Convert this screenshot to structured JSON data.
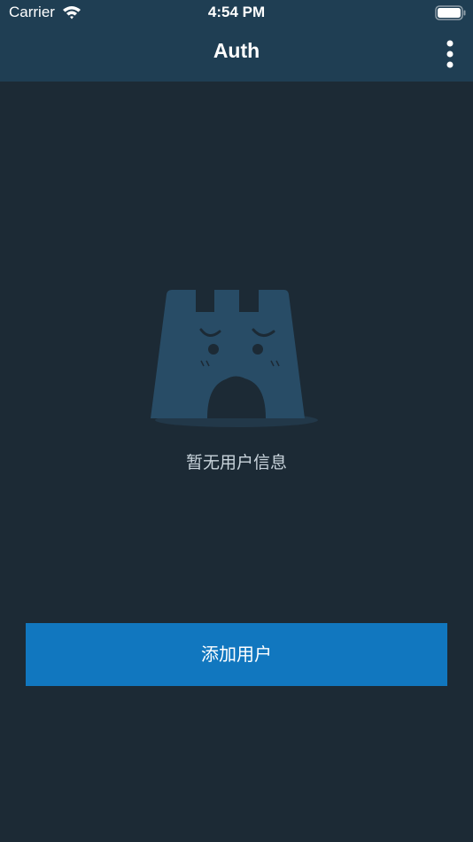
{
  "status_bar": {
    "carrier": "Carrier",
    "time": "4:54 PM",
    "wifi_icon": "wifi-icon",
    "battery_icon": "battery-icon"
  },
  "nav": {
    "title": "Auth",
    "more_icon": "vertical-ellipsis-icon"
  },
  "empty_state": {
    "illustration_icon": "sad-castle-icon",
    "message": "暂无用户信息"
  },
  "actions": {
    "add_user_label": "添加用户"
  },
  "colors": {
    "background": "#1c2a35",
    "header": "#1f3e53",
    "primary_button": "#1177bf",
    "illustration": "#284c66"
  }
}
